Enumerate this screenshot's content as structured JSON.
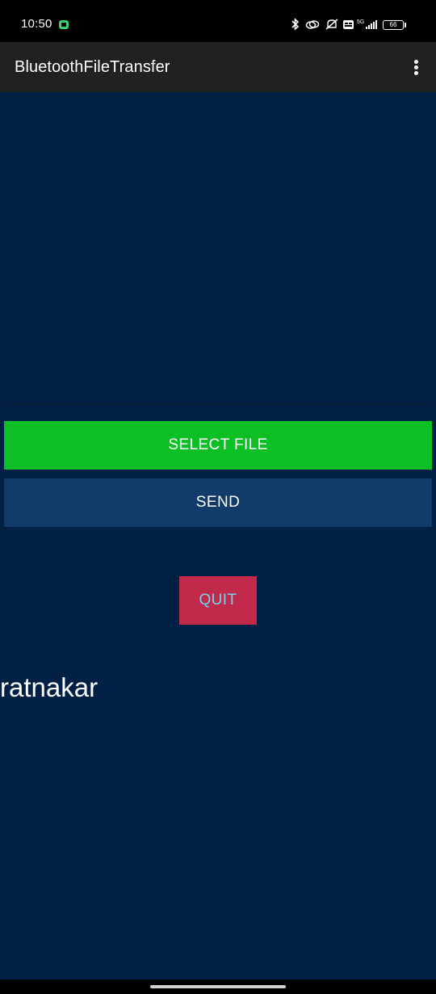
{
  "status_bar": {
    "time": "10:50",
    "battery_level": "66",
    "icons": [
      "bluetooth-icon",
      "link-icon",
      "mute-icon",
      "volte-icon",
      "signal-5g-icon",
      "battery-icon"
    ]
  },
  "app_bar": {
    "title": "BluetoothFileTransfer",
    "overflow_icon": "more-vert-icon"
  },
  "main": {
    "select_file_label": "SELECT FILE",
    "send_label": "SEND",
    "quit_label": "QUIT",
    "user_name": "ratnakar"
  },
  "colors": {
    "background": "#002046",
    "app_bar": "#212121",
    "select_file_button": "#0bbf24",
    "send_button": "#113b6b",
    "quit_button": "#c12a4a",
    "quit_text": "#74d3ee"
  }
}
